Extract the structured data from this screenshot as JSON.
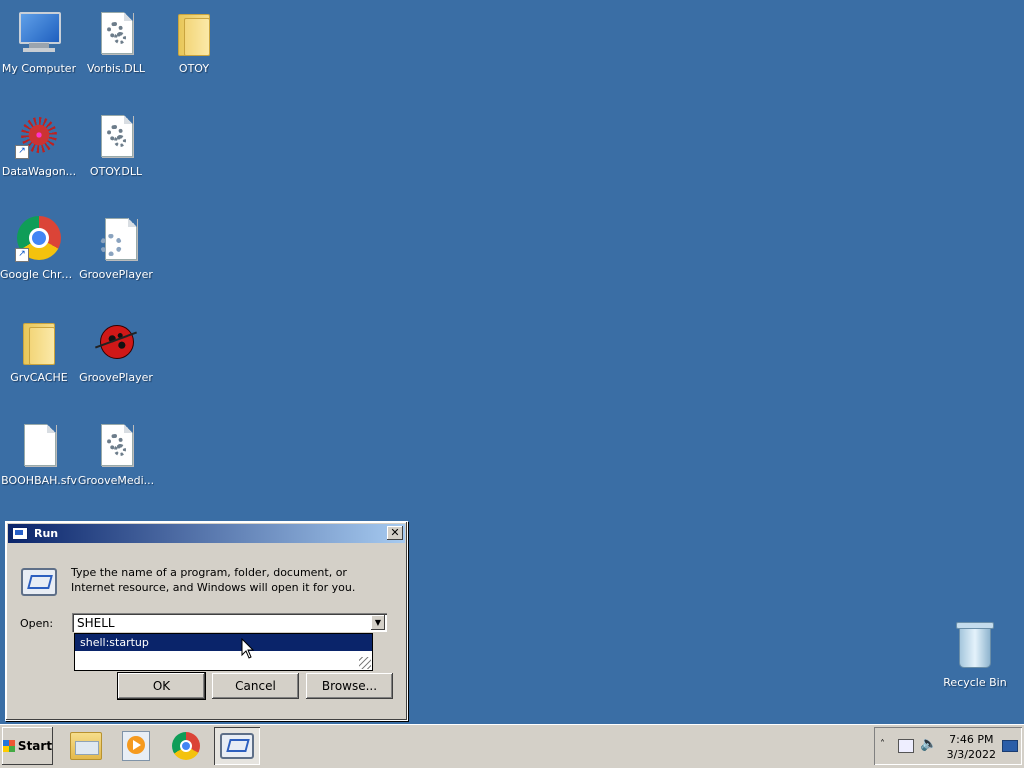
{
  "desktop": {
    "icons": [
      {
        "label": "My Computer",
        "icon": "computer-icon"
      },
      {
        "label": "Vorbis.DLL",
        "icon": "dll-file-icon"
      },
      {
        "label": "OTOY",
        "icon": "folder-icon"
      },
      {
        "label": "DataWagon...",
        "icon": "datawagon-shortcut-icon"
      },
      {
        "label": "OTOY.DLL",
        "icon": "dll-file-icon"
      },
      {
        "label": "Google Chrome",
        "icon": "chrome-icon"
      },
      {
        "label": "GroovePlayer",
        "icon": "config-file-icon"
      },
      {
        "label": "GrvCACHE",
        "icon": "folder-icon"
      },
      {
        "label": "GroovePlayer",
        "icon": "ladybug-icon"
      },
      {
        "label": "BOOHBAH.sfv",
        "icon": "blank-file-icon"
      },
      {
        "label": "GrooveMedi...",
        "icon": "dll-file-icon"
      }
    ],
    "recycle_bin": {
      "label": "Recycle Bin"
    },
    "background_color": "#3a6ea5"
  },
  "run_dialog": {
    "title": "Run",
    "close_glyph": "✕",
    "description": "Type the name of a program, folder, document, or Internet resource, and Windows will open it for you.",
    "open_label": "Open:",
    "input_value": "SHELL",
    "suggestions": [
      "shell:startup"
    ],
    "buttons": {
      "ok": "OK",
      "cancel": "Cancel",
      "browse": "Browse..."
    }
  },
  "taskbar": {
    "start_label": "Start",
    "pinned": [
      "explorer-icon",
      "media-player-icon",
      "chrome-icon",
      "run-icon"
    ],
    "tray": {
      "time": "7:46 PM",
      "date": "3/3/2022",
      "icons": [
        "show-hidden-icon",
        "network-icon",
        "volume-icon",
        "action-center-icon"
      ]
    }
  }
}
